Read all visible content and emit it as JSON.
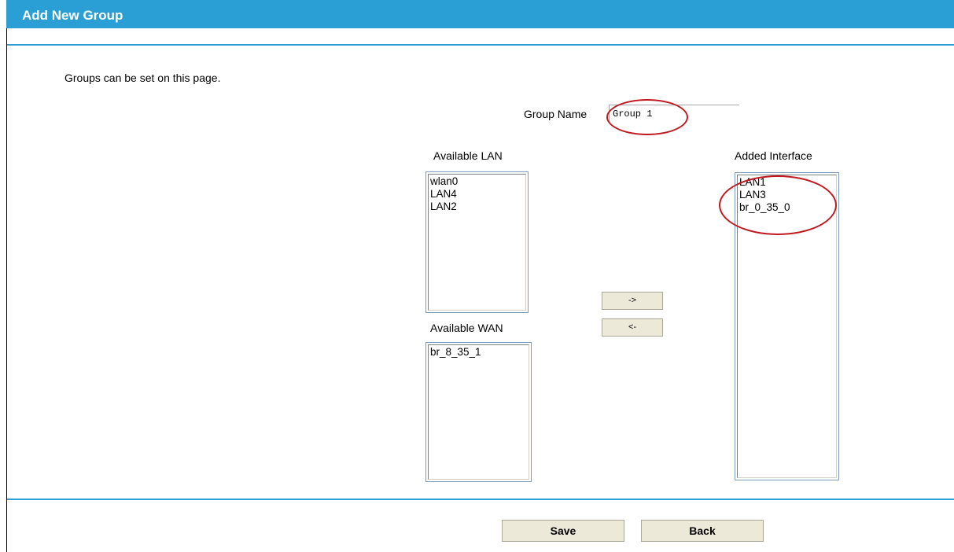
{
  "header": {
    "title": "Add New Group"
  },
  "description": "Groups can be set on this page.",
  "group_name": {
    "label": "Group Name",
    "value": "Group 1"
  },
  "available_lan": {
    "label": "Available LAN",
    "items": [
      "wlan0",
      "LAN4",
      "LAN2"
    ]
  },
  "available_wan": {
    "label": "Available WAN",
    "items": [
      "br_8_35_1"
    ]
  },
  "added_interface": {
    "label": "Added Interface",
    "items": [
      "LAN1",
      "LAN3",
      "br_0_35_0"
    ]
  },
  "buttons": {
    "add": "->",
    "remove": "<-",
    "save": "Save",
    "back": "Back"
  },
  "colors": {
    "header": "#2a9fd6",
    "annotation": "#c0181e"
  }
}
